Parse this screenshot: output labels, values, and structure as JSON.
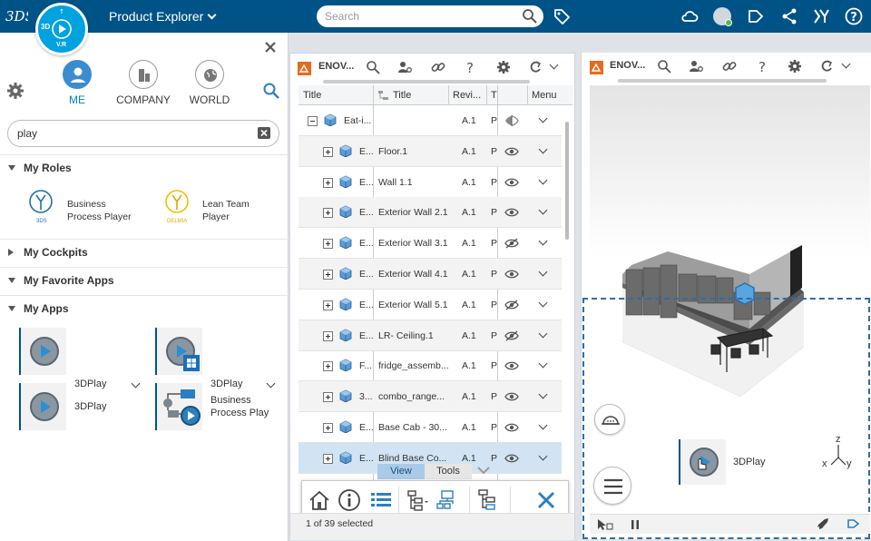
{
  "header": {
    "app_title": "Product Explorer",
    "search_placeholder": "Search",
    "compass_labels": [
      "3D",
      "V.R"
    ]
  },
  "left_panel": {
    "tabs": [
      {
        "label": "ME",
        "active": true
      },
      {
        "label": "COMPANY",
        "active": false
      },
      {
        "label": "WORLD",
        "active": false
      }
    ],
    "filter_value": "play",
    "sections": {
      "roles": "My Roles",
      "cockpits": "My Cockpits",
      "favorites": "My Favorite Apps",
      "apps": "My Apps"
    },
    "roles": [
      {
        "line1": "Business",
        "line2": "Process Player",
        "badge": "3DS"
      },
      {
        "line1": "Lean Team",
        "line2": "Player",
        "badge": "DELMIA"
      }
    ],
    "apps": [
      {
        "label": "3DPlay"
      },
      {
        "label": "3DPlay"
      },
      {
        "label": "3DPlay"
      },
      {
        "line1": "Business",
        "line2": "Process Play"
      }
    ]
  },
  "mid_panel": {
    "title": "ENOV...",
    "columns": [
      "Title",
      "Title",
      "Revi...",
      "T",
      "Menu"
    ],
    "rows": [
      {
        "c1": "Eat-i...",
        "title": "",
        "rev": "A.1",
        "t": "P",
        "eye": "partial",
        "expand": "minus"
      },
      {
        "c1": "E...",
        "title": "Floor.1",
        "rev": "A.1",
        "t": "P",
        "eye": "on",
        "expand": "plus"
      },
      {
        "c1": "E...",
        "title": "Wall 1.1",
        "rev": "A.1",
        "t": "P",
        "eye": "on",
        "expand": "plus"
      },
      {
        "c1": "E...",
        "title": "Exterior Wall 2.1",
        "rev": "A.1",
        "t": "P",
        "eye": "on",
        "expand": "plus"
      },
      {
        "c1": "E...",
        "title": "Exterior Wall 3.1",
        "rev": "A.1",
        "t": "P",
        "eye": "off",
        "expand": "plus"
      },
      {
        "c1": "E...",
        "title": "Exterior Wall 4.1",
        "rev": "A.1",
        "t": "P",
        "eye": "on",
        "expand": "plus"
      },
      {
        "c1": "E...",
        "title": "Exterior Wall 5.1",
        "rev": "A.1",
        "t": "P",
        "eye": "off",
        "expand": "plus"
      },
      {
        "c1": "E...",
        "title": "LR- Ceiling.1",
        "rev": "A.1",
        "t": "P",
        "eye": "off",
        "expand": "plus"
      },
      {
        "c1": "F...",
        "title": "fridge_assemb...",
        "rev": "A.1",
        "t": "P",
        "eye": "on",
        "expand": "plus"
      },
      {
        "c1": "3...",
        "title": "combo_range...",
        "rev": "A.1",
        "t": "P",
        "eye": "on",
        "expand": "plus"
      },
      {
        "c1": "E...",
        "title": "Base Cab - 30...",
        "rev": "A.1",
        "t": "P",
        "eye": "on",
        "expand": "plus"
      },
      {
        "c1": "E...",
        "title": "Blind Base Co...",
        "rev": "A.1",
        "t": "P",
        "eye": "on",
        "expand": "plus",
        "selected": true
      }
    ],
    "tool_tabs": [
      "View",
      "Tools"
    ],
    "selection_status": "1 of 39 selected"
  },
  "right_panel": {
    "title": "ENOV...",
    "dragged_app_label": "3DPlay",
    "axis_labels": [
      "z",
      "x",
      "y"
    ]
  },
  "colors": {
    "topbar": "#005386",
    "accent": "#3a8cd1",
    "compass": "#00a2e0",
    "selection": "#d2e4f3"
  }
}
